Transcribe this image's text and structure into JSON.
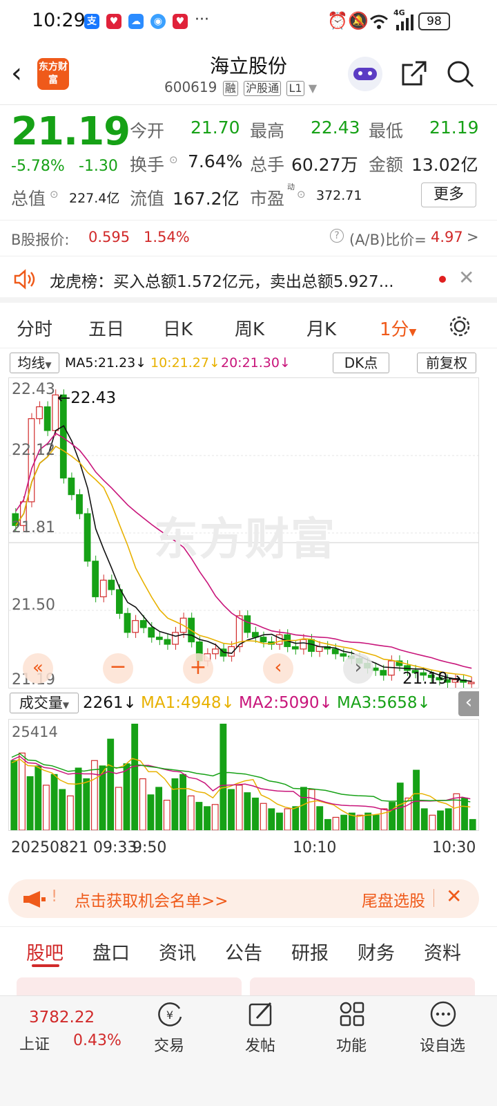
{
  "status_bar": {
    "time": "10:29",
    "battery": "98",
    "network": "4G",
    "dots": "···"
  },
  "header": {
    "back_icon": "back-arrow-icon",
    "logo_text": "东方财富",
    "title": "海立股份",
    "code": "600619",
    "tags": [
      "融",
      "沪股通",
      "L1"
    ]
  },
  "quote": {
    "price": "21.19",
    "change_pct": "-5.78%",
    "change": "-1.30",
    "open_label": "今开",
    "open": "21.70",
    "high_label": "最高",
    "high": "22.43",
    "low_label": "最低",
    "low": "21.19",
    "turnover_label": "换手",
    "turnover": "7.64%",
    "volume_label": "总手",
    "volume": "60.27万",
    "amount_label": "金额",
    "amount": "13.02亿",
    "mktcap_label": "总值",
    "mktcap": "227.4亿",
    "float_label": "流值",
    "float": "167.2亿",
    "pe_label": "市盈",
    "pe_sup": "动",
    "pe": "372.71",
    "more": "更多"
  },
  "bshare": {
    "label": "B股报价:",
    "price": "0.595",
    "pct": "1.54%",
    "ratio_label": "(A/B)比价=",
    "ratio": "4.97",
    "arrow": ">"
  },
  "dragon": {
    "text": "龙虎榜：买入总额1.572亿元，卖出总额5.927..."
  },
  "chart_tabs": [
    "分时",
    "五日",
    "日K",
    "周K",
    "月K",
    "1分"
  ],
  "ma_row": {
    "type": "均线",
    "ma5": "MA5:21.23↓",
    "ma10": "10:21.27↓",
    "ma20": "20:21.30↓",
    "dk": "DK点",
    "adjust": "前复权"
  },
  "kchart_labels": {
    "y_max": "22.43",
    "y_2": "22.12",
    "y_3": "21.81",
    "y_4": "21.50",
    "y_min": "21.19",
    "high_marker": "←22.43",
    "low_marker": "21.19→",
    "watermark": "东方财富"
  },
  "volume_row": {
    "type": "成交量",
    "cur": "2261↓",
    "ma1": "MA1:4948↓",
    "ma2": "MA2:5090↓",
    "ma3": "MA3:5658↓",
    "vmax": "25414"
  },
  "time_axis": {
    "t0": "20250821 09:33",
    "t1": "9:50",
    "t2": "10:10",
    "t3": "10:30"
  },
  "banner": {
    "left": "点击获取机会名单>>",
    "right": "尾盘选股",
    "fade": "!"
  },
  "bottom_tabs": [
    "股吧",
    "盘口",
    "资讯",
    "公告",
    "研报",
    "财务",
    "资料"
  ],
  "bottom_nav": {
    "index_value": "3782.22",
    "index_name": "上证",
    "index_pct": "0.43%",
    "items": [
      "交易",
      "发帖",
      "功能",
      "设自选"
    ]
  },
  "colors": {
    "up": "#d12a2a",
    "down": "#16a116",
    "ma5": "#111111",
    "ma10": "#e8b100",
    "ma20": "#c8147a",
    "accent": "#ef5a1a"
  }
}
